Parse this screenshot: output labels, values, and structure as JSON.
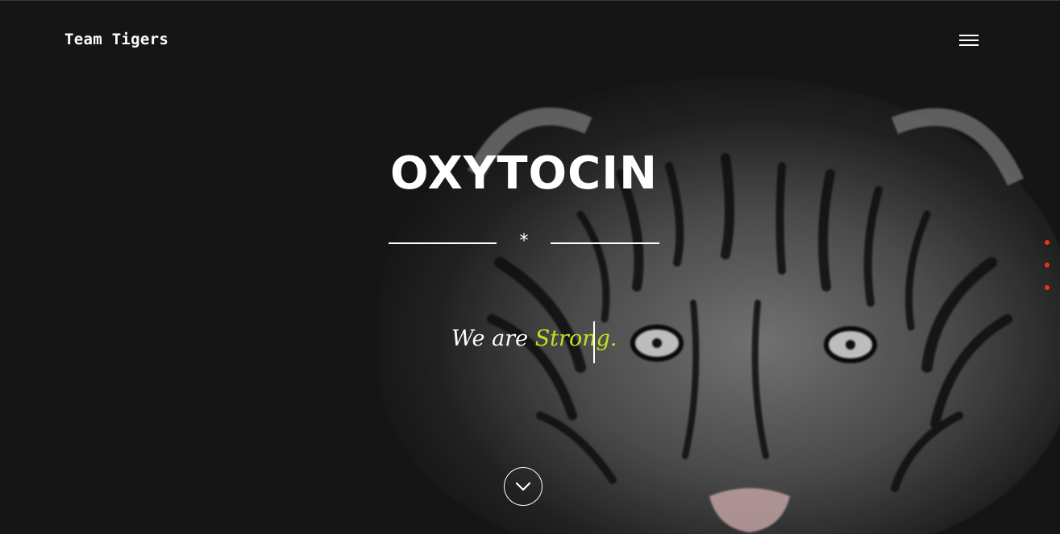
{
  "header": {
    "brand": "Team Tigers",
    "menu_icon": "hamburger-menu-icon"
  },
  "hero": {
    "title": "OXYTOCIN",
    "divider_symbol": "*",
    "tagline_prefix": "We are ",
    "tagline_accent": "Strong.",
    "scroll_icon": "chevron-down-icon",
    "background_image": "tiger-face"
  },
  "section_nav": {
    "dots": 3
  },
  "colors": {
    "background": "#151515",
    "text": "#ffffff",
    "accent": "#c6e020",
    "nav_dot": "#e8380d"
  }
}
